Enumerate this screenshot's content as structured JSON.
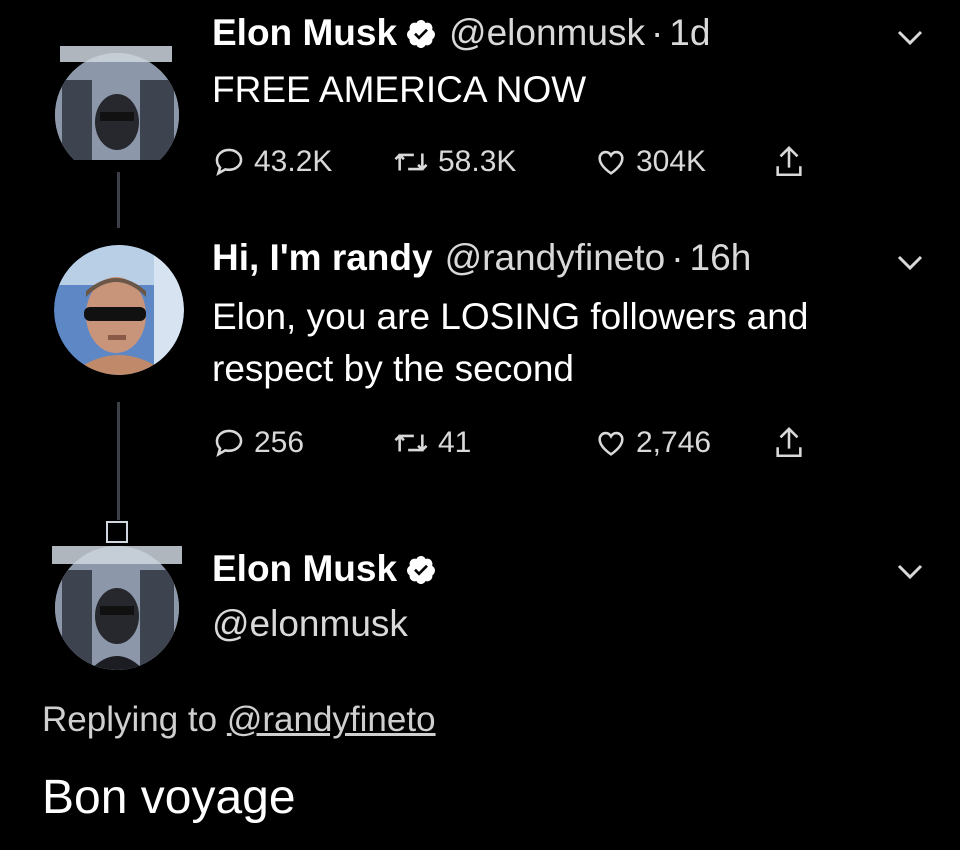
{
  "tweets": [
    {
      "name": "Elon Musk",
      "handle": "@elonmusk",
      "time": "1d",
      "text": "FREE AMERICA NOW",
      "replies": "43.2K",
      "retweets": "58.3K",
      "likes": "304K"
    },
    {
      "name": "Hi, I'm randy",
      "handle": "@randyfineto",
      "time": "16h",
      "text_line1": "Elon, you are LOSING followers and",
      "text_line2": "respect by the second",
      "replies": "256",
      "retweets": "41",
      "likes": "2,746"
    }
  ],
  "main_tweet": {
    "name": "Elon Musk",
    "handle": "@elonmusk",
    "replying_prefix": "Replying to",
    "replying_to": "@randyfineto",
    "text": "Bon voyage"
  },
  "icons": {
    "verified": "verified-badge-icon",
    "reply": "reply-icon",
    "retweet": "retweet-icon",
    "like": "heart-icon",
    "share": "share-icon",
    "menu": "chevron-down-icon"
  },
  "colors": {
    "background": "#000000",
    "text": "#ffffff",
    "secondary_text": "#d9d9d9",
    "thread_line": "#3d4147"
  }
}
